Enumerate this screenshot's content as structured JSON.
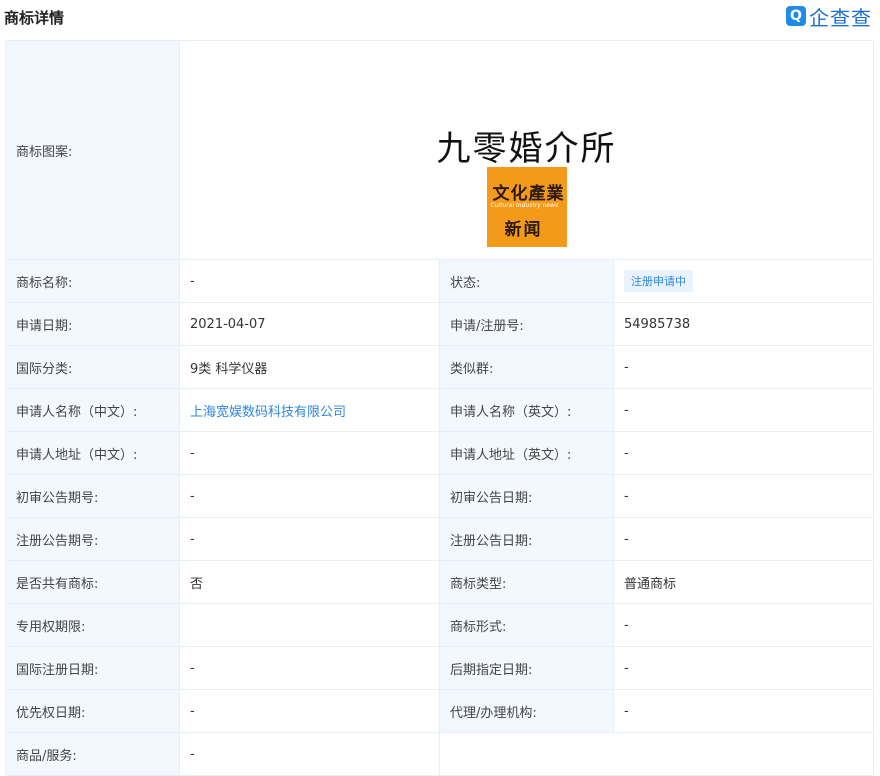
{
  "header": {
    "title": "商标详情",
    "brand_logo": "Q",
    "brand_name": "企查查"
  },
  "mark_image": {
    "label": "商标图案:",
    "text": "九零婚介所",
    "stamp_line1": "文化產業",
    "stamp_line2": "Cultural Industry news",
    "stamp_line3": "新闻"
  },
  "rows": [
    {
      "l1": "商标名称:",
      "v1": "-",
      "l2": "状态:",
      "v2": "注册申请中"
    },
    {
      "l1": "申请日期:",
      "v1": "2021-04-07",
      "l2": "申请/注册号:",
      "v2": "54985738"
    },
    {
      "l1": "国际分类:",
      "v1": "9类 科学仪器",
      "l2": "类似群:",
      "v2": "-"
    },
    {
      "l1": "申请人名称（中文）:",
      "v1": "上海宽娱数码科技有限公司",
      "l2": "申请人名称（英文）:",
      "v2": "-"
    },
    {
      "l1": "申请人地址（中文）:",
      "v1": "-",
      "l2": "申请人地址（英文）:",
      "v2": "-"
    },
    {
      "l1": "初审公告期号:",
      "v1": "-",
      "l2": "初审公告日期:",
      "v2": "-"
    },
    {
      "l1": "注册公告期号:",
      "v1": "-",
      "l2": "注册公告日期:",
      "v2": "-"
    },
    {
      "l1": "是否共有商标:",
      "v1": "否",
      "l2": "商标类型:",
      "v2": "普通商标"
    },
    {
      "l1": "专用权期限:",
      "v1": "",
      "l2": "商标形式:",
      "v2": "-"
    },
    {
      "l1": "国际注册日期:",
      "v1": "-",
      "l2": "后期指定日期:",
      "v2": "-"
    },
    {
      "l1": "优先权日期:",
      "v1": "-",
      "l2": "代理/办理机构:",
      "v2": "-"
    },
    {
      "l1": "商品/服务:",
      "v1": "-"
    }
  ]
}
